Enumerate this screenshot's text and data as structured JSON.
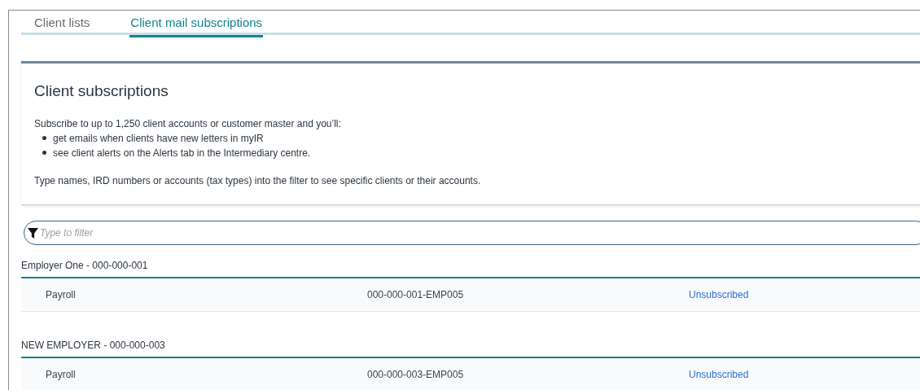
{
  "tabs": [
    {
      "label": "Client lists",
      "selected": false
    },
    {
      "label": "Client mail subscriptions",
      "selected": true
    }
  ],
  "intro": {
    "title": "Client subscriptions",
    "lead": "Subscribe to up to 1,250 client accounts or customer master and you’ll:",
    "bullets": [
      "get emails when clients have new letters in myIR",
      "see client alerts on the Alerts tab in the Intermediary centre."
    ],
    "note": "Type names, IRD numbers or accounts (tax types) into the filter to see specific clients or their accounts."
  },
  "filter": {
    "placeholder": "Type to filter"
  },
  "groups": [
    {
      "title": "Employer One - 000-000-001",
      "rows": [
        {
          "account": "Payroll",
          "number": "000-000-001-EMP005",
          "status": "Unsubscribed"
        }
      ]
    },
    {
      "title": "NEW EMPLOYER - 000-000-003",
      "rows": [
        {
          "account": "Payroll",
          "number": "000-000-003-EMP005",
          "status": "Unsubscribed"
        }
      ]
    }
  ]
}
